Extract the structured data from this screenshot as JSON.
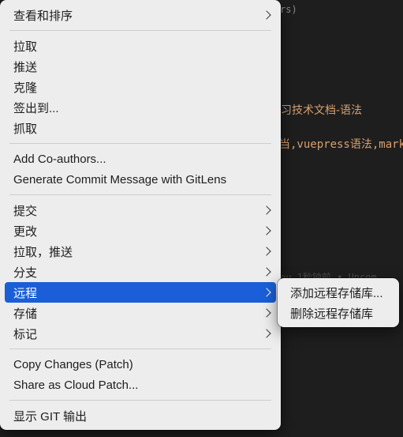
{
  "background": {
    "line1": "rs)",
    "line2": "习技术文档-语法",
    "line3": "当,vuepress语法,mark",
    "line4": "ou  1秒钟前 • Uncom"
  },
  "menu": {
    "view_sort": "查看和排序",
    "pull": "拉取",
    "push": "推送",
    "clone": "克隆",
    "checkout": "签出到...",
    "fetch": "抓取",
    "add_coauthors": "Add Co-authors...",
    "generate_commit": "Generate Commit Message with GitLens",
    "commit": "提交",
    "changes": "更改",
    "pull_push": "拉取，推送",
    "branch": "分支",
    "remote": "远程",
    "stash": "存储",
    "tags": "标记",
    "copy_changes": "Copy Changes (Patch)",
    "share_cloud_patch": "Share as Cloud Patch...",
    "show_git_output": "显示 GIT 输出"
  },
  "submenu": {
    "add_remote": "添加远程存储库...",
    "remove_remote": "删除远程存储库"
  },
  "colors": {
    "menu_bg": "#ededed",
    "highlight": "#1a5fd7",
    "editor_bg": "#1e1e1e"
  }
}
